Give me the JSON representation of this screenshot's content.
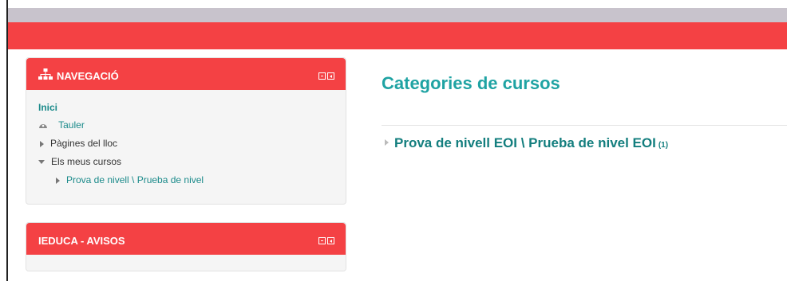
{
  "colors": {
    "brand_red": "#f44144",
    "teal": "#1fa3a3",
    "top_gray": "#c8c3cc"
  },
  "navigation_block": {
    "title": "NAVEGACIÓ",
    "icon": "sitemap-icon",
    "items": {
      "home": "Inici",
      "dashboard": "Tauler",
      "site_pages": "Pàgines del lloc",
      "my_courses": "Els meus cursos",
      "course": "Prova de nivell \\ Prueba de nivel"
    }
  },
  "notices_block": {
    "title": "IEDUCA - AVISOS"
  },
  "main": {
    "title": "Categories de cursos",
    "categories": [
      {
        "label": "Prova de nivell EOI \\ Prueba de nivel EOI",
        "count": "(1)"
      }
    ]
  }
}
